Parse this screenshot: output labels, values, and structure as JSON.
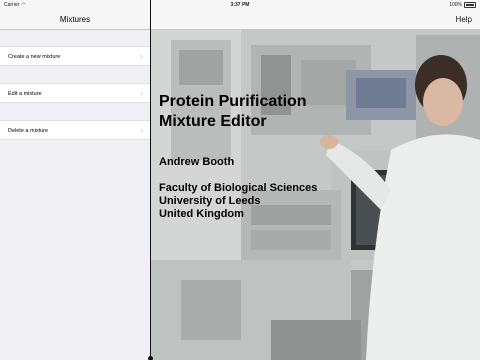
{
  "status_bar": {
    "carrier": "Carrier",
    "time": "3:37 PM",
    "battery": "100%"
  },
  "master": {
    "title": "Mixtures",
    "items": [
      {
        "label": "Create a new mixture"
      },
      {
        "label": "Edit a mixture"
      },
      {
        "label": "Delete a mixture"
      }
    ]
  },
  "detail": {
    "help_label": "Help",
    "title_line1": "Protein Purification",
    "title_line2": "Mixture Editor",
    "author": "Andrew Booth",
    "affiliation_line1": "Faculty of Biological Sciences",
    "affiliation_line2": "University of Leeds",
    "affiliation_line3": "United Kingdom"
  }
}
